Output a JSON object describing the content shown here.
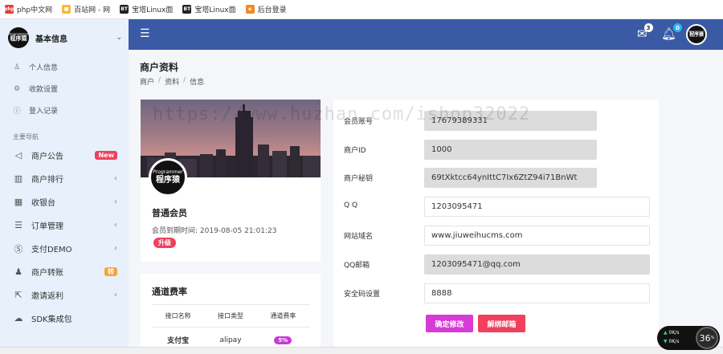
{
  "bookmarks": [
    {
      "label": "php中文网",
      "icon": "php-cn-icon",
      "color": "#e53935",
      "glyph": "php"
    },
    {
      "label": "百站网 - 网",
      "icon": "baizhan-icon",
      "color": "#f6b93b",
      "glyph": "■"
    },
    {
      "label": "宝塔Linux面",
      "icon": "baota-icon",
      "color": "#222222",
      "glyph": "BT"
    },
    {
      "label": "宝塔Linux面",
      "icon": "baota-icon",
      "color": "#222222",
      "glyph": "BT"
    },
    {
      "label": "后台登录",
      "icon": "ie-icon",
      "color": "#f08a24",
      "glyph": "e"
    }
  ],
  "sidebar": {
    "logo_small": "Programmer",
    "logo_big": "程序猿",
    "title": "基本信息",
    "sub_items": [
      {
        "label": "个人信息",
        "icon": "user-icon"
      },
      {
        "label": "收款设置",
        "icon": "gear-icon"
      },
      {
        "label": "登入记录",
        "icon": "info-icon"
      }
    ],
    "section_label": "主要导航",
    "nav_items": [
      {
        "label": "商户公告",
        "icon": "megaphone-icon",
        "badge": "New"
      },
      {
        "label": "商户排行",
        "icon": "bar-chart-icon"
      },
      {
        "label": "收银台",
        "icon": "grid-icon"
      },
      {
        "label": "订单管理",
        "icon": "list-icon"
      },
      {
        "label": "支付DEMO",
        "icon": "coin-icon"
      },
      {
        "label": "商户转账",
        "icon": "users-icon",
        "badge": "转"
      },
      {
        "label": "邀请返利",
        "icon": "share-icon"
      },
      {
        "label": "SDK集成包",
        "icon": "cloud-icon"
      }
    ]
  },
  "topbar": {
    "mail_count": "3",
    "bell_count": "0",
    "avatar_small": "Programmer",
    "avatar_big": "程序猿"
  },
  "page": {
    "title": "商户资料",
    "breadcrumb": [
      "商户",
      "资料",
      "信息"
    ],
    "watermark": "https://www.huzhan.com/ishop32022"
  },
  "profile": {
    "avatar_small": "Programmer",
    "avatar_big": "程序猿",
    "level": "普通会员",
    "expire_label": "会员到期时间:",
    "expire_value": "2019-08-05 21:01:23",
    "upgrade": "升级"
  },
  "rates": {
    "title": "通道费率",
    "headers": [
      "接口名称",
      "接口类型",
      "通道费率"
    ],
    "rows": [
      {
        "name": "支付宝",
        "type": "alipay",
        "rate": "5%"
      }
    ]
  },
  "form": {
    "fields": [
      {
        "label": "会员账号",
        "value": "17679389331",
        "readonly": true
      },
      {
        "label": "商户ID",
        "value": "1000",
        "readonly": true
      },
      {
        "label": "商户秘钥",
        "value": "69tXktcc64ynIttC7Ix6ZtZ94i71BnWt",
        "readonly": true
      },
      {
        "label": "Q Q",
        "value": "1203095471",
        "readonly": false
      },
      {
        "label": "网站域名",
        "value": "www.jiuweihucms.com",
        "readonly": false
      },
      {
        "label": "QQ邮箱",
        "value": "1203095471@qq.com",
        "readonly": true
      },
      {
        "label": "安全码设置",
        "value": "8888",
        "readonly": false
      }
    ],
    "confirm_button": "确定修改",
    "unbind_button": "解绑邮箱"
  },
  "speed": {
    "up": "0K/s",
    "down": "0K/s",
    "percent": "36",
    "percent_unit": "%"
  },
  "colors": {
    "topbar": "#3a5aa6",
    "sidebar": "#e7f0fb",
    "confirm": "#d63bd6",
    "unbind": "#f1405c"
  }
}
